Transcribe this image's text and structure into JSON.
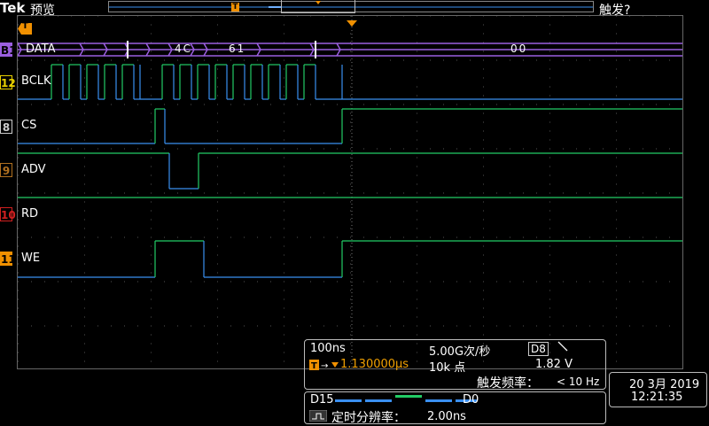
{
  "header": {
    "brand": "Tek",
    "mode": "预览",
    "trigger_status": "触发?",
    "trigger_marker": "T"
  },
  "channels": {
    "bus": {
      "tag": "B1",
      "label": "DATA",
      "values": [
        "4C",
        "61",
        "00"
      ],
      "color": "#9b5fe0"
    },
    "c12": {
      "tag": "12",
      "label": "BCLK",
      "color": "#e8d000"
    },
    "c8": {
      "tag": "8",
      "label": "CS",
      "color": "#cccccc"
    },
    "c9": {
      "tag": "9",
      "label": "ADV",
      "color": "#b07020"
    },
    "c10": {
      "tag": "10",
      "label": "RD",
      "color": "#d02020"
    },
    "c11": {
      "tag": "11",
      "label": "WE",
      "color": "#f09000"
    }
  },
  "timebase": {
    "scale": "100ns",
    "sample_rate": "5.00G次/秒",
    "trigger_pos": "1.130000μs",
    "record_length": "10k 点",
    "trig_source": "D8",
    "trig_level": "1.82 V",
    "trig_freq_label": "触发频率：",
    "trig_freq_value": "< 10 Hz"
  },
  "digital": {
    "left": "D15",
    "right": "D0",
    "resolution_label": "定时分辨率：",
    "resolution_value": "2.00ns"
  },
  "datetime": {
    "date": "20 3月 2019",
    "time": "12:21:35"
  },
  "colors": {
    "high": "#22cc66",
    "low": "#3a8ff0",
    "grid": "#555555"
  }
}
